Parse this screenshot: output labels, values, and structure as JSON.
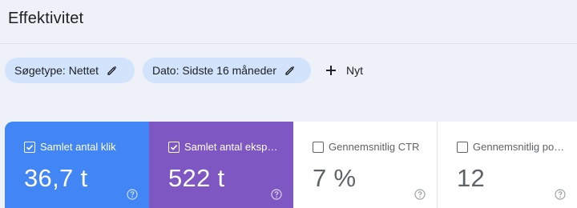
{
  "header": {
    "title": "Effektivitet"
  },
  "filters": {
    "chips": [
      {
        "label": "Søgetype: Nettet",
        "icon": "pencil-icon"
      },
      {
        "label": "Dato: Sidste 16 måneder",
        "icon": "pencil-icon"
      }
    ],
    "new_label": "Nyt"
  },
  "metrics": [
    {
      "label": "Samlet antal klik",
      "value": "36,7 t",
      "checked": true,
      "color": "#4285f4"
    },
    {
      "label": "Samlet antal eksp…",
      "value": "522 t",
      "checked": true,
      "color": "#7e57c2"
    },
    {
      "label": "Gennemsnitlig CTR",
      "value": "7 %",
      "checked": false,
      "color": "#ffffff"
    },
    {
      "label": "Gennemsnitlig po…",
      "value": "12",
      "checked": false,
      "color": "#ffffff"
    }
  ]
}
